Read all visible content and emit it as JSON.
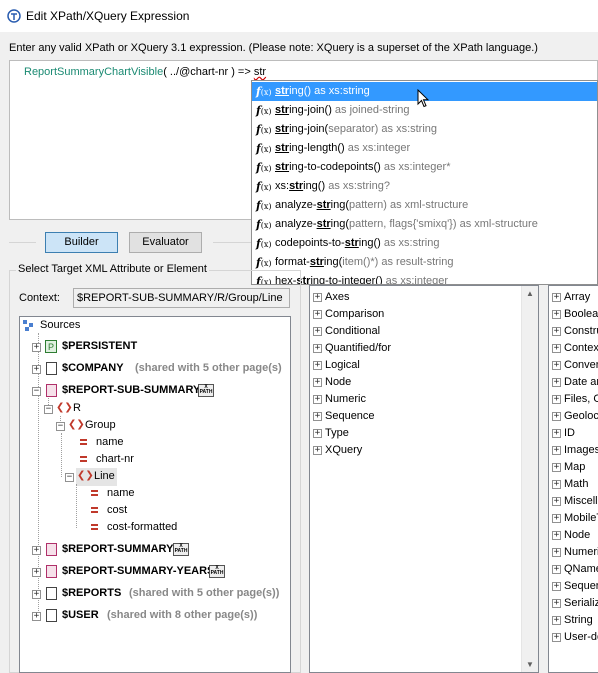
{
  "window": {
    "title": "Edit XPath/XQuery Expression"
  },
  "instruction": "Enter any valid XPath or XQuery 3.1 expression. (Please note: XQuery is a superset of the XPath language.)",
  "editor": {
    "fn_name": "ReportSummaryChartVisible",
    "open_paren": "( ",
    "arg": "../@chart-nr",
    "close_rest": " ) => ",
    "typed": "str"
  },
  "autocomplete": {
    "items": [
      {
        "pre": "",
        "hi": "str",
        "post": "ing()",
        "dim": " as xs:string"
      },
      {
        "pre": "",
        "hi": "str",
        "post": "ing-join()",
        "dim": " as joined-string"
      },
      {
        "pre": "",
        "hi": "str",
        "post": "ing-join(",
        "dim": "separator) as xs:string"
      },
      {
        "pre": "",
        "hi": "str",
        "post": "ing-length()",
        "dim": " as xs:integer"
      },
      {
        "pre": "",
        "hi": "str",
        "post": "ing-to-codepoints()",
        "dim": " as xs:integer*"
      },
      {
        "pre": "xs:",
        "hi": "str",
        "post": "ing()",
        "dim": " as xs:string?"
      },
      {
        "pre": "analyze-",
        "hi": "str",
        "post": "ing(",
        "dim": "pattern) as xml-structure"
      },
      {
        "pre": "analyze-",
        "hi": "str",
        "post": "ing(",
        "dim": "pattern, flags{'smixq'}) as xml-structure"
      },
      {
        "pre": "codepoints-to-",
        "hi": "str",
        "post": "ing()",
        "dim": " as xs:string"
      },
      {
        "pre": "format-",
        "hi": "str",
        "post": "ing(",
        "dim": "item()*) as result-string"
      },
      {
        "pre": "hex-",
        "hi": "str",
        "post": "ing-to-integer()",
        "dim": " as xs:integer"
      }
    ]
  },
  "buttons": {
    "builder": "Builder",
    "evaluator": "Evaluator"
  },
  "target_group": {
    "label": "Select Target XML Attribute or Element"
  },
  "context": {
    "label": "Context:",
    "value": "$REPORT-SUB-SUMMARY/R/Group/Line"
  },
  "tree": {
    "sources": "Sources",
    "persistent": "$PERSISTENT",
    "company": "$COMPANY",
    "company_note": "(shared with 5 other page(s)",
    "sub_summary": "$REPORT-SUB-SUMMARY",
    "r": "R",
    "group": "Group",
    "name": "name",
    "chart_nr": "chart-nr",
    "line": "Line",
    "line_name": "name",
    "cost": "cost",
    "cost_formatted": "cost-formatted",
    "summary": "$REPORT-SUMMARY",
    "summary_years": "$REPORT-SUMMARY-YEARS",
    "reports": "$REPORTS",
    "reports_note": "(shared with 5 other page(s))",
    "user": "$USER",
    "user_note": "(shared with 8 other page(s))"
  },
  "operators": [
    "Axes",
    "Comparison",
    "Conditional",
    "Quantified/for",
    "Logical",
    "Node",
    "Numeric",
    "Sequence",
    "Type",
    "XQuery"
  ],
  "functions": [
    "Array",
    "Boolea",
    "Constru",
    "Contex",
    "Conver",
    "Date ar",
    "Files, O",
    "Geoloc",
    "ID",
    "Images",
    "Map",
    "Math",
    "Miscella",
    "MobileT",
    "Node",
    "Numeri",
    "QName",
    "Sequer",
    "Serializ",
    "String",
    "User-de"
  ]
}
